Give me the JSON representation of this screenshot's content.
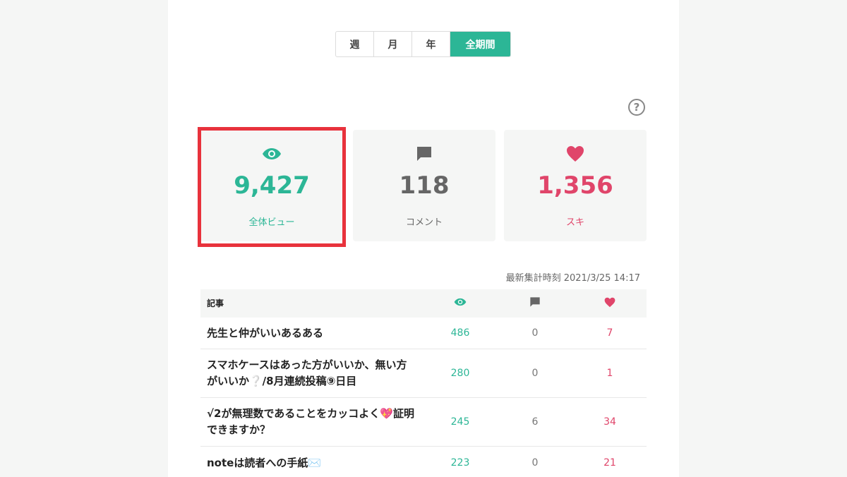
{
  "tabs": [
    {
      "label": "週",
      "active": false
    },
    {
      "label": "月",
      "active": false
    },
    {
      "label": "年",
      "active": false
    },
    {
      "label": "全期間",
      "active": true
    }
  ],
  "colors": {
    "accent": "#2cb696",
    "like": "#e0456a",
    "highlight": "#e8323c",
    "comment": "#777777"
  },
  "stats": {
    "views": {
      "value": "9,427",
      "label": "全体ビュー",
      "icon": "eye-icon"
    },
    "comments": {
      "value": "118",
      "label": "コメント",
      "icon": "comment-icon"
    },
    "likes": {
      "value": "1,356",
      "label": "スキ",
      "icon": "heart-icon"
    }
  },
  "updated": "最新集計時刻 2021/3/25 14:17",
  "table": {
    "header": {
      "title": "記事",
      "views_icon": "eye-icon",
      "comments_icon": "comment-icon",
      "likes_icon": "heart-icon"
    },
    "rows": [
      {
        "title": "先生と仲がいいあるある",
        "views": "486",
        "comments": "0",
        "likes": "7"
      },
      {
        "title": "スマホケースはあった方がいいか、無い方がいいか❔/8月連続投稿⑨日目",
        "views": "280",
        "comments": "0",
        "likes": "1"
      },
      {
        "title": "√2が無理数であることをカッコよく💖証明できますか？",
        "views": "245",
        "comments": "6",
        "likes": "34"
      },
      {
        "title": "noteは読者への手紙✉️",
        "views": "223",
        "comments": "0",
        "likes": "21"
      }
    ]
  }
}
